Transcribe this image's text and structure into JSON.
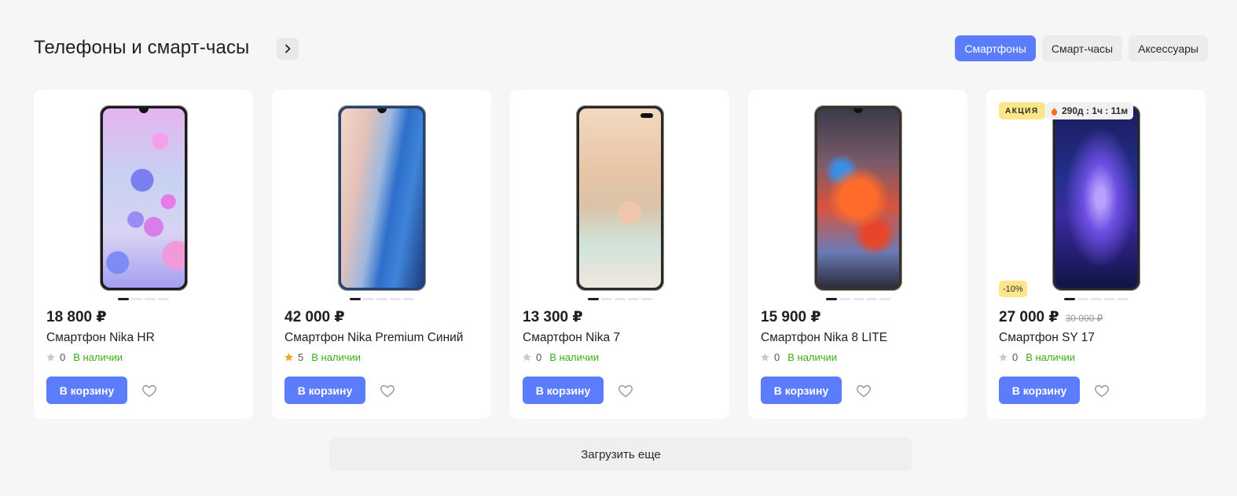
{
  "header": {
    "title": "Телефоны и смарт-часы",
    "tabs": [
      {
        "label": "Смартфоны",
        "active": true
      },
      {
        "label": "Смарт-часы",
        "active": false
      },
      {
        "label": "Аксессуары",
        "active": false
      }
    ]
  },
  "products": [
    {
      "price": "18 800 ₽",
      "name": "Смартфон Nika HR",
      "rating": "0",
      "stock": "В наличии",
      "cart": "В корзину"
    },
    {
      "price": "42 000 ₽",
      "name": "Смартфон Nika Premium Синий",
      "rating": "5",
      "stock": "В наличии",
      "cart": "В корзину"
    },
    {
      "price": "13 300 ₽",
      "name": "Смартфон Nika 7",
      "rating": "0",
      "stock": "В наличии",
      "cart": "В корзину"
    },
    {
      "price": "15 900 ₽",
      "name": "Смартфон Nika 8 LITE",
      "rating": "0",
      "stock": "В наличии",
      "cart": "В корзину"
    },
    {
      "price": "27 000 ₽",
      "old_price": "30 000 ₽",
      "name": "Смартфон SY 17",
      "rating": "0",
      "stock": "В наличии",
      "cart": "В корзину",
      "sale_badge": "АКЦИЯ",
      "timer": "290д : 1ч : 11м",
      "discount": "-10%"
    }
  ],
  "load_more": "Загрузить еще",
  "colors": {
    "accent": "#5c7dfb",
    "in_stock": "#3dab18",
    "star_active": "#f5a623",
    "star_inactive": "#c9c9c9",
    "badge": "#fde68a"
  },
  "icons": [
    "chevron-right-icon",
    "star-icon",
    "heart-icon",
    "fire-icon"
  ]
}
